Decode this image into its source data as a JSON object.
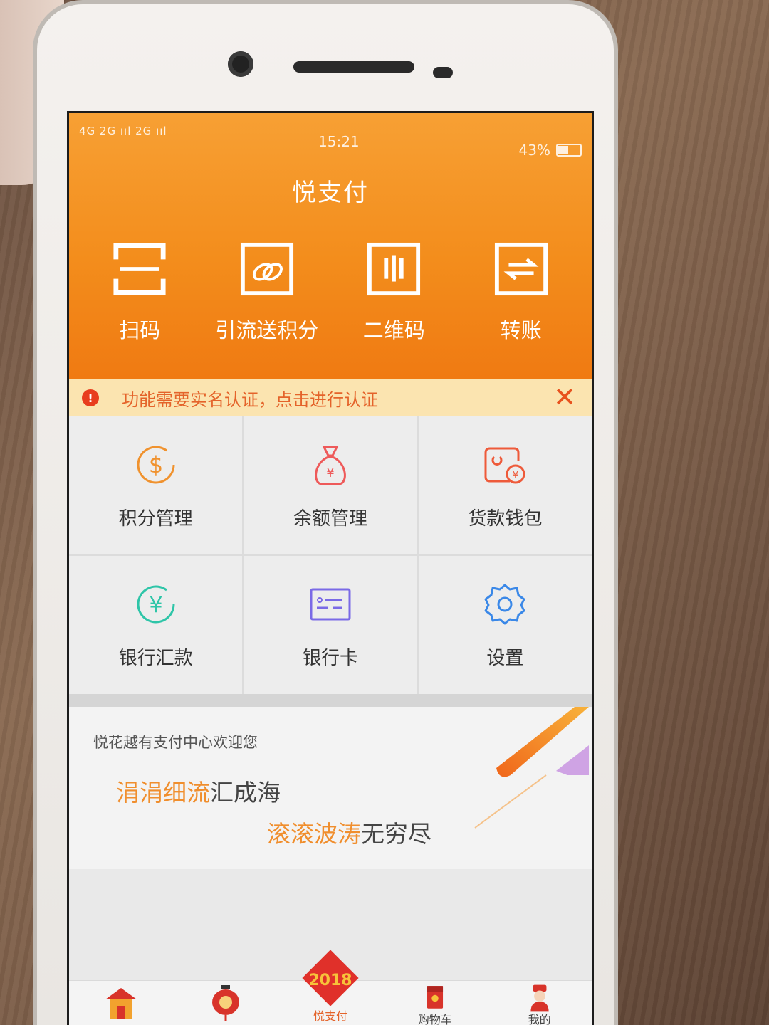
{
  "status_bar": {
    "signal": "4G 2G ııl 2G ııl",
    "time": "15:21",
    "battery_text": "43%",
    "battery_level": 0.43
  },
  "header": {
    "title": "悦支付",
    "actions": [
      {
        "label": "扫码",
        "icon": "scan-icon"
      },
      {
        "label": "引流送积分",
        "icon": "coins-icon"
      },
      {
        "label": "二维码",
        "icon": "qrcode-icon"
      },
      {
        "label": "转账",
        "icon": "transfer-icon"
      }
    ]
  },
  "notice": {
    "text": "功能需要实名认证，点击进行认证",
    "icon": "info-icon",
    "close": "✕"
  },
  "grid": [
    {
      "label": "积分管理",
      "icon": "dollar-icon",
      "color": "#f0922e"
    },
    {
      "label": "余额管理",
      "icon": "money-bag-icon",
      "color": "#ee5a5a"
    },
    {
      "label": "货款钱包",
      "icon": "wallet-icon",
      "color": "#ee5a3a"
    },
    {
      "label": "银行汇款",
      "icon": "yuan-circle-icon",
      "color": "#2ec5a8"
    },
    {
      "label": "银行卡",
      "icon": "bank-card-icon",
      "color": "#7a6ae6"
    },
    {
      "label": "设置",
      "icon": "gear-icon",
      "color": "#3a88e8"
    }
  ],
  "banner": {
    "welcome": "悦花越有支付中心欢迎您",
    "line1_highlight": "涓涓细流",
    "line1_rest": "汇成海",
    "line2_highlight": "滚滚波涛",
    "line2_rest": "无穷尽"
  },
  "tabbar": [
    {
      "label": "",
      "icon": "home-house-icon"
    },
    {
      "label": "",
      "icon": "lantern-icon"
    },
    {
      "label": "悦支付",
      "icon": "2018-badge-icon"
    },
    {
      "label": "购物车",
      "icon": "cart-envelope-icon"
    },
    {
      "label": "我的",
      "icon": "fortune-god-icon"
    }
  ]
}
